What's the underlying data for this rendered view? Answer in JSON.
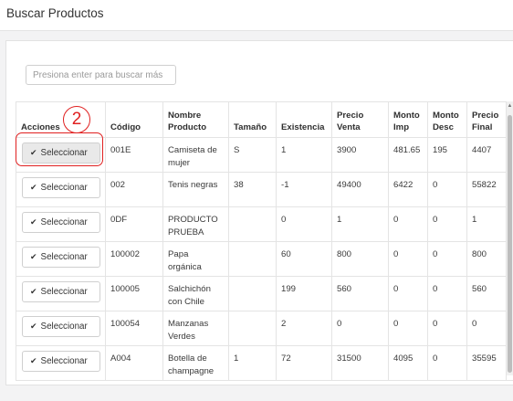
{
  "page": {
    "title": "Buscar Productos"
  },
  "search": {
    "placeholder": "Presiona enter para buscar más"
  },
  "annotation": {
    "number": "2"
  },
  "table": {
    "headers": {
      "acciones": "Acciones",
      "codigo": "Código",
      "nombre": "Nombre Producto",
      "tamano": "Tamaño",
      "existencia": "Existencia",
      "precio_venta": "Precio Venta",
      "monto_imp": "Monto Imp",
      "monto_desc": "Monto Desc",
      "precio_final": "Precio Final"
    },
    "select_label": "Seleccionar",
    "rows": [
      {
        "codigo": "001E",
        "nombre": "Camiseta de mujer",
        "tamano": "S",
        "existencia": "1",
        "precio_venta": "3900",
        "monto_imp": "481.65",
        "monto_desc": "195",
        "precio_final": "4407"
      },
      {
        "codigo": "002",
        "nombre": "Tenis negras",
        "tamano": "38",
        "existencia": "-1",
        "precio_venta": "49400",
        "monto_imp": "6422",
        "monto_desc": "0",
        "precio_final": "55822"
      },
      {
        "codigo": "0DF",
        "nombre": "PRODUCTO PRUEBA",
        "tamano": "",
        "existencia": "0",
        "precio_venta": "1",
        "monto_imp": "0",
        "monto_desc": "0",
        "precio_final": "1"
      },
      {
        "codigo": "100002",
        "nombre": "Papa orgánica",
        "tamano": "",
        "existencia": "60",
        "precio_venta": "800",
        "monto_imp": "0",
        "monto_desc": "0",
        "precio_final": "800"
      },
      {
        "codigo": "100005",
        "nombre": "Salchichón con Chile",
        "tamano": "",
        "existencia": "199",
        "precio_venta": "560",
        "monto_imp": "0",
        "monto_desc": "0",
        "precio_final": "560"
      },
      {
        "codigo": "100054",
        "nombre": "Manzanas Verdes",
        "tamano": "",
        "existencia": "2",
        "precio_venta": "0",
        "monto_imp": "0",
        "monto_desc": "0",
        "precio_final": "0"
      },
      {
        "codigo": "A004",
        "nombre": "Botella de champagne",
        "tamano": "1",
        "existencia": "72",
        "precio_venta": "31500",
        "monto_imp": "4095",
        "monto_desc": "0",
        "precio_final": "35595"
      }
    ]
  },
  "icons": {
    "check": "check-icon"
  }
}
